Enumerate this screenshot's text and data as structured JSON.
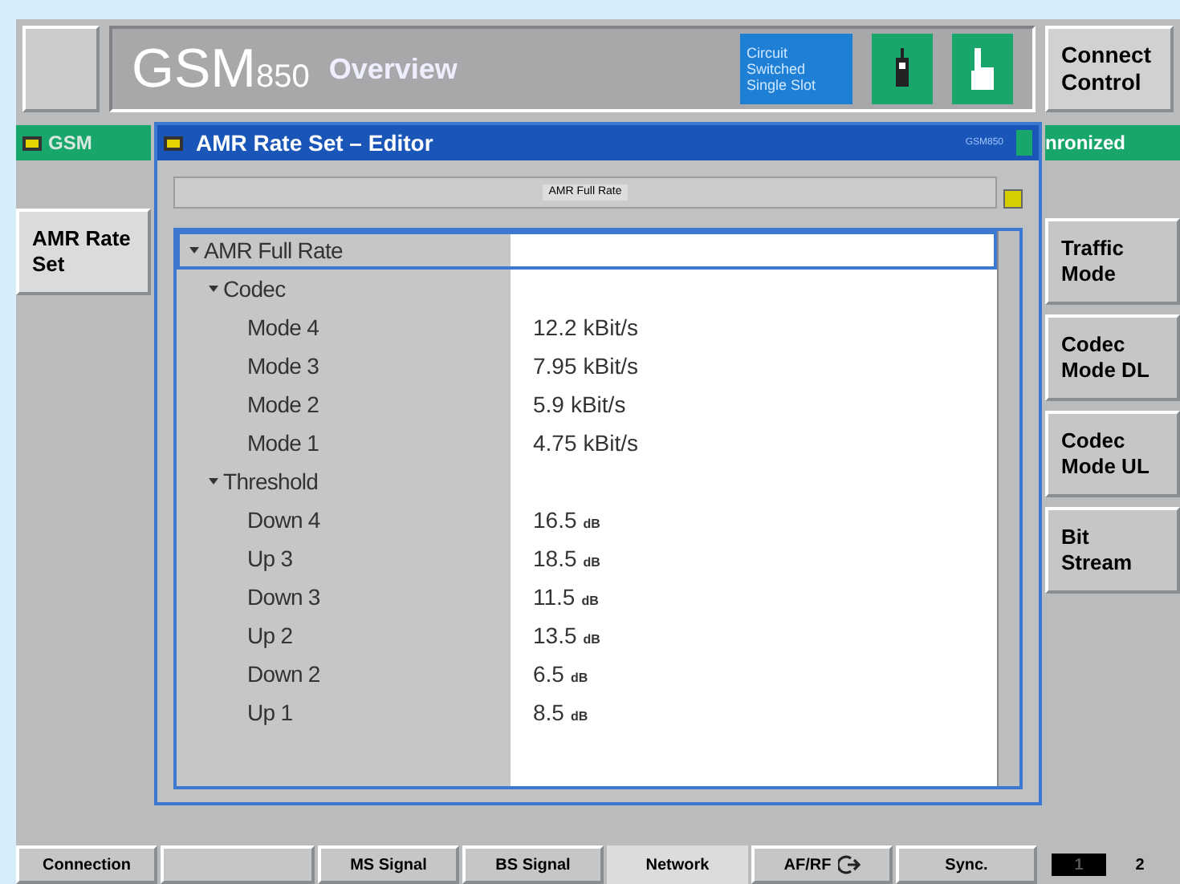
{
  "header": {
    "title": "GSM",
    "title_sub": "850",
    "subtitle": "Overview",
    "status": "Circuit Switched Single Slot",
    "connect_button": "Connect Control"
  },
  "tab_left": "GSM",
  "tab_right": "nronized",
  "left_softkeys": [
    {
      "label": "AMR Rate Set",
      "selected": true
    }
  ],
  "right_softkeys": [
    {
      "label": "Traffic Mode"
    },
    {
      "label": "Codec Mode DL"
    },
    {
      "label": "Codec Mode UL"
    },
    {
      "label": "Bit Stream"
    }
  ],
  "editor": {
    "title": "AMR Rate Set – Editor",
    "badge": "GSM850",
    "tab": "AMR Full Rate",
    "tree": [
      {
        "label": "AMR Full Rate",
        "expanded": true,
        "selected": true,
        "children": [
          {
            "label": "Codec",
            "expanded": true,
            "children": [
              {
                "label": "Mode 4",
                "value": "12.2",
                "unit": "kBit/s"
              },
              {
                "label": "Mode 3",
                "value": "7.95",
                "unit": "kBit/s"
              },
              {
                "label": "Mode 2",
                "value": "5.9",
                "unit": "kBit/s"
              },
              {
                "label": "Mode 1",
                "value": "4.75",
                "unit": "kBit/s"
              }
            ]
          },
          {
            "label": "Threshold",
            "expanded": true,
            "children": [
              {
                "label": "Down 4",
                "value": "16.5",
                "unit": "dB"
              },
              {
                "label": "Up 3",
                "value": "18.5",
                "unit": "dB"
              },
              {
                "label": "Down 3",
                "value": "11.5",
                "unit": "dB"
              },
              {
                "label": "Up 2",
                "value": "13.5",
                "unit": "dB"
              },
              {
                "label": "Down 2",
                "value": "6.5",
                "unit": "dB"
              },
              {
                "label": "Up 1",
                "value": "8.5",
                "unit": "dB"
              }
            ]
          }
        ]
      }
    ]
  },
  "bottom_tabs": [
    {
      "label": "Connection",
      "selected": false
    },
    {
      "selected": false
    },
    {
      "label": "MS Signal",
      "selected": false
    },
    {
      "label": "BS Signal",
      "selected": false
    },
    {
      "label": "Network",
      "selected": true
    },
    {
      "label": "AF/RF",
      "selected": false,
      "arrow": true
    },
    {
      "label": "Sync.",
      "selected": false
    }
  ],
  "pages": [
    {
      "label": "1",
      "selected": true
    },
    {
      "label": "2",
      "selected": false
    }
  ]
}
